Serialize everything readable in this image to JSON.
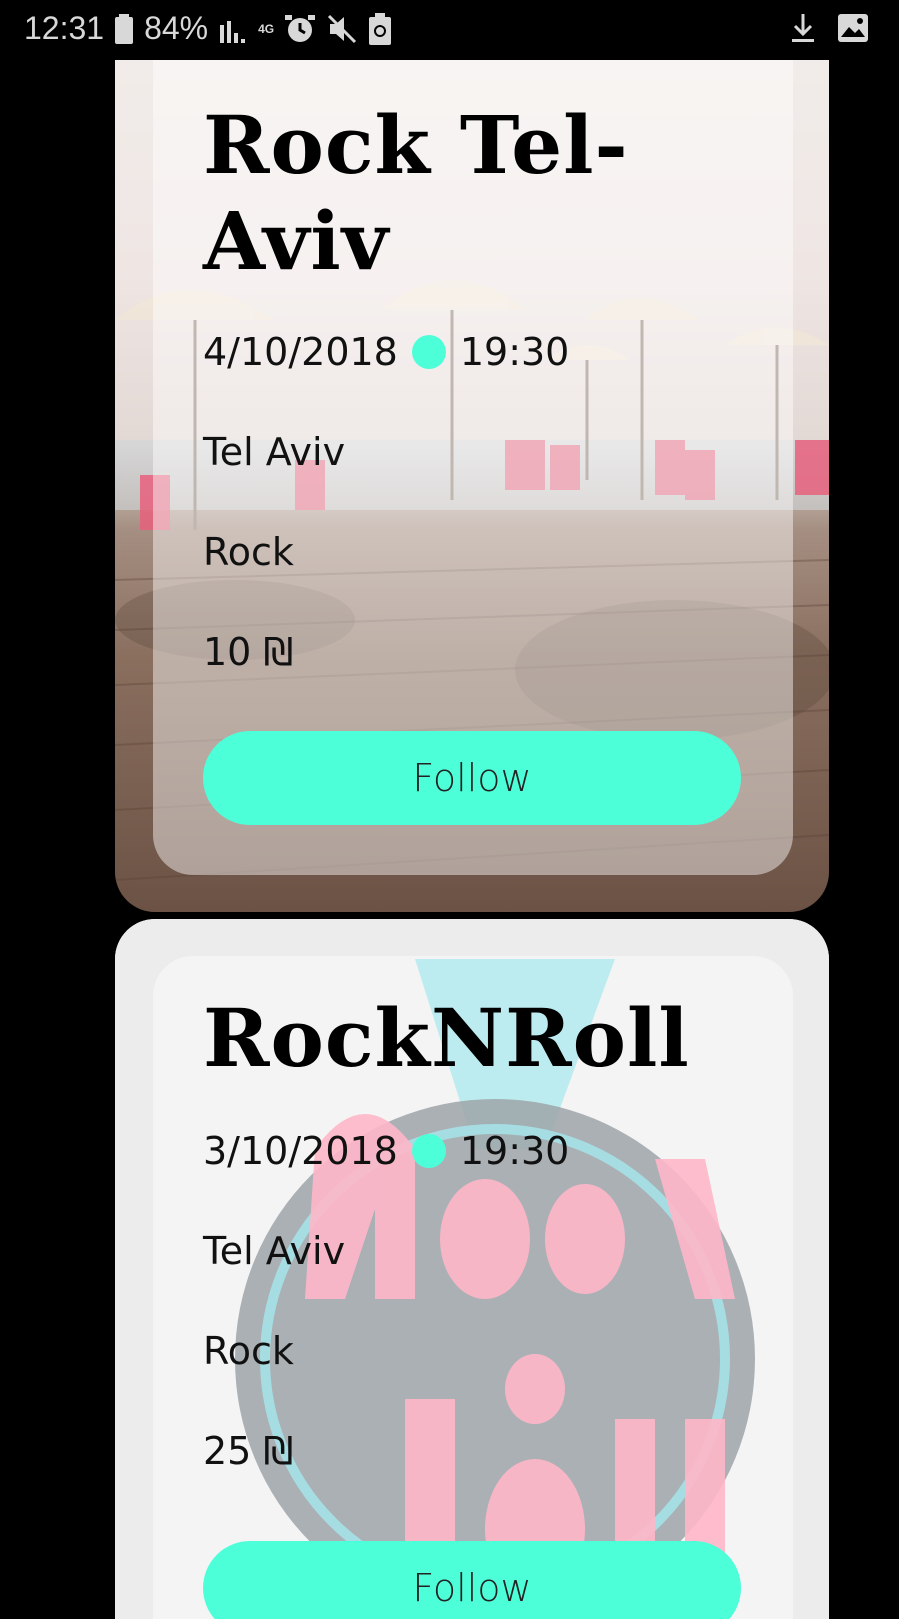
{
  "status_bar": {
    "time": "12:31",
    "battery": "84%",
    "network": "4G",
    "icons": [
      "battery-icon",
      "signal-icon",
      "network-4g-icon",
      "alarm-icon",
      "mute-icon",
      "recycle-icon",
      "download-icon",
      "image-icon"
    ]
  },
  "events": [
    {
      "title": "Rock Tel-Aviv",
      "date": "4/10/2018",
      "time": "19:30",
      "location": "Tel Aviv",
      "genre": "Rock",
      "price": "10 ₪",
      "follow_label": "Follow",
      "background": "beach-boardwalk-image"
    },
    {
      "title": "RockNRoll",
      "date": "3/10/2018",
      "time": "19:30",
      "location": "Tel Aviv",
      "genre": "Rock",
      "price": "25 ₪",
      "follow_label": "Follow",
      "background": "rock-and-roll-logo-image"
    }
  ],
  "colors": {
    "accent": "#4dffd9",
    "background": "#000000"
  }
}
